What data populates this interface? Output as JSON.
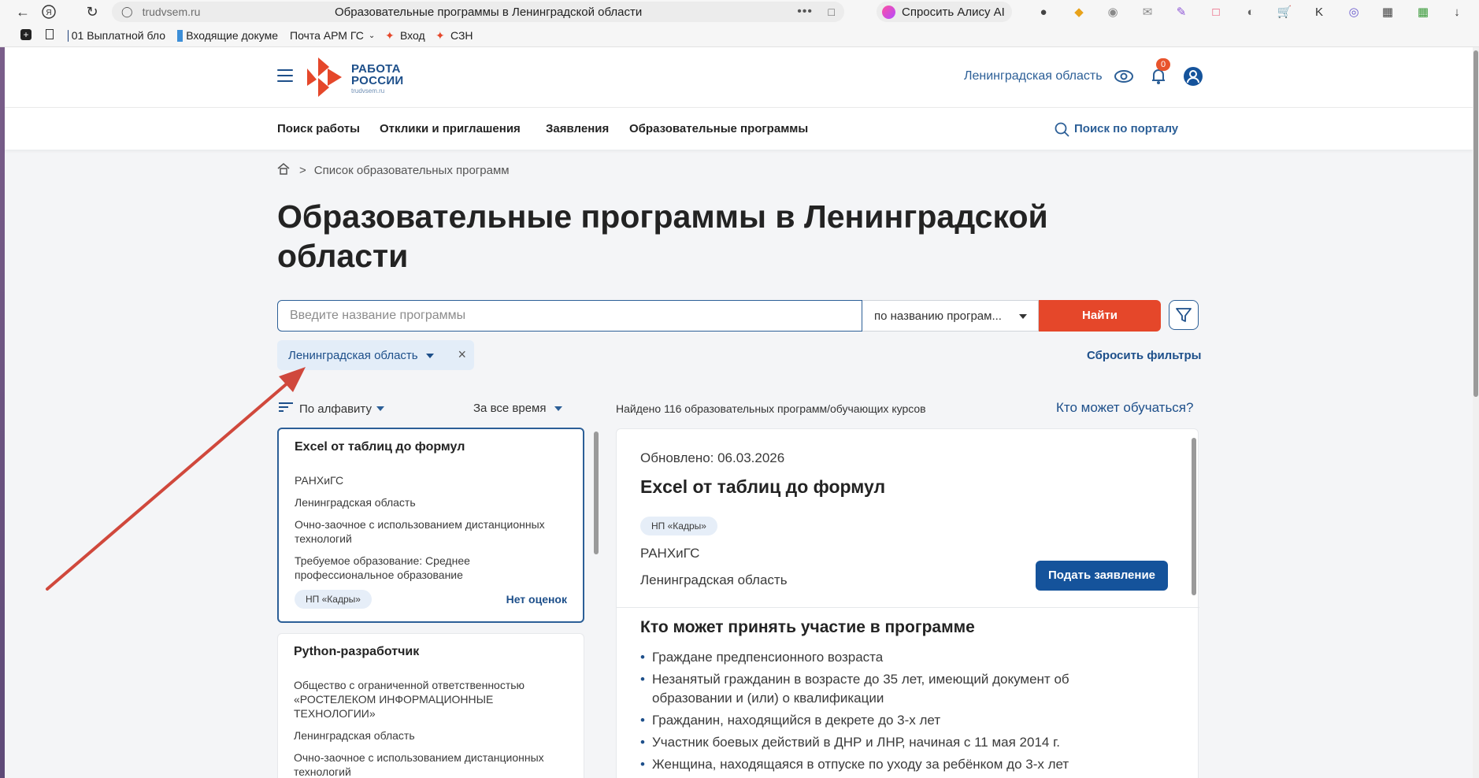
{
  "browser": {
    "url": "trudvsem.ru",
    "tab_title": "Образовательные программы в Ленинградской области",
    "alice_label": "Спросить Алису AI",
    "bookmarks": [
      {
        "label": "01 Выплатной бло"
      },
      {
        "label": "Входящие докуме"
      },
      {
        "label": "Почта АРМ ГС"
      },
      {
        "label": "Вход"
      },
      {
        "label": "СЗН"
      }
    ]
  },
  "header": {
    "logo_line1": "РАБОТА",
    "logo_line2": "РОССИИ",
    "logo_sub": "trudvsem.ru",
    "region": "Ленинградская область",
    "notifications_count": "0"
  },
  "nav": {
    "items": [
      "Поиск работы",
      "Отклики и приглашения",
      "Заявления",
      "Образовательные программы"
    ],
    "portal_search": "Поиск по порталу"
  },
  "breadcrumb": {
    "sep": ">",
    "current": "Список образовательных программ"
  },
  "page_title": "Образовательные программы в Ленинградской области",
  "search": {
    "placeholder": "Введите название программы",
    "value": "",
    "mode": "по названию програм...",
    "find_label": "Найти"
  },
  "filters": {
    "region_chip": "Ленинградская область",
    "reset_label": "Сбросить фильтры"
  },
  "sorting": {
    "alpha": "По алфавиту",
    "time": "За все время"
  },
  "found_text": "Найдено 116 образовательных программ/обучающих курсов",
  "who_can_link": "Кто может обучаться?",
  "cards": [
    {
      "title": "Excel от таблиц до формул",
      "org": "РАНХиГС",
      "region": "Ленинградская область",
      "form": "Очно-заочное с использованием дистанционных технологий",
      "education": "Требуемое образование: Среднее профессиональное образование",
      "tag": "НП «Кадры»",
      "rating": "Нет оценок"
    },
    {
      "title": "Python-разработчик",
      "org": "Общество с ограниченной ответственностью «РОСТЕЛЕКОМ ИНФОРМАЦИОННЫЕ ТЕХНОЛОГИИ»",
      "region": "Ленинградская область",
      "form": "Очно-заочное с использованием дистанционных технологий"
    }
  ],
  "detail": {
    "updated": "Обновлено: 06.03.2026",
    "title": "Excel от таблиц до формул",
    "tag": "НП «Кадры»",
    "org": "РАНХиГС",
    "region": "Ленинградская область",
    "apply_label": "Подать заявление",
    "who_heading": "Кто может принять участие в программе",
    "who_list": [
      "Граждане предпенсионного возраста",
      "Незанятый гражданин в возрасте до 35 лет, имеющий документ об образовании и (или) о квалификации",
      "Гражданин, находящийся в декрете до 3-х лет",
      "Участник боевых действий в ДНР и ЛНР, начиная с 11 мая 2014 г.",
      "Женщина, находящаяся в отпуске по уходу за ребёнком до 3-х лет"
    ]
  },
  "colors": {
    "accent_blue": "#1d4f8a",
    "brand_orange": "#e5472a",
    "annotation_arrow": "#d0483c"
  }
}
